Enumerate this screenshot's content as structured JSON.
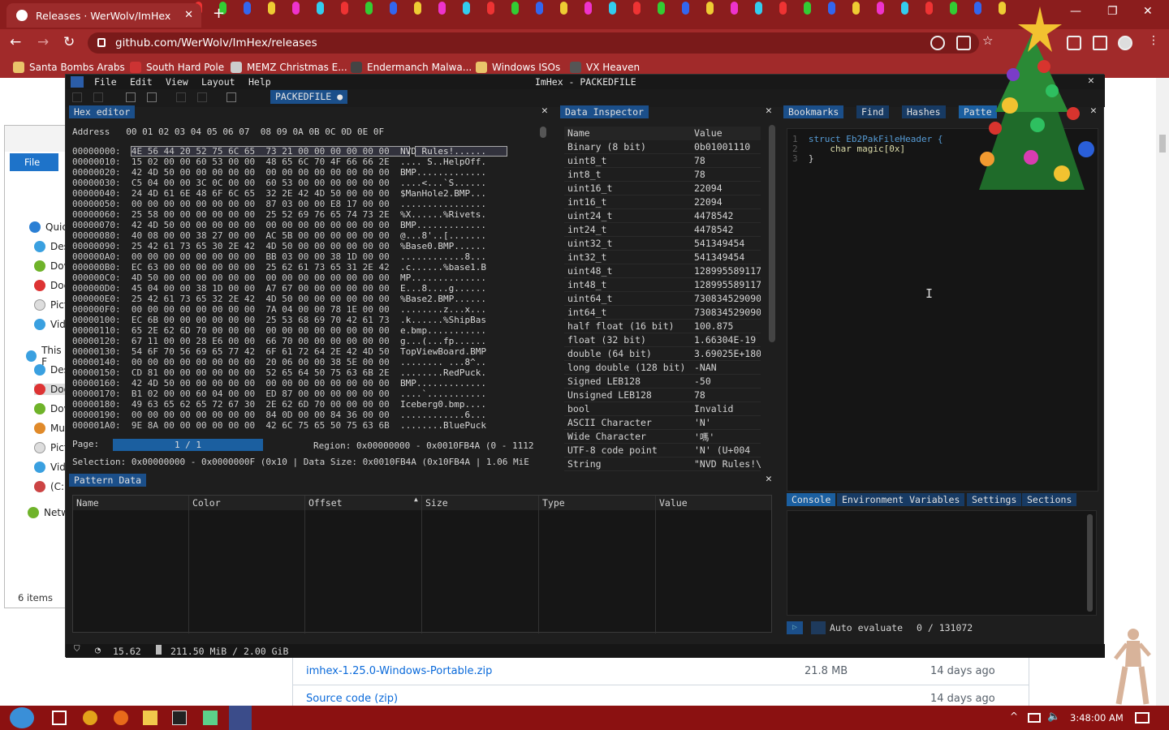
{
  "browser": {
    "tab_title": "Releases · WerWolv/ImHex",
    "url": "github.com/WerWolv/ImHex/releases",
    "bookmarks": [
      "Santa Bombs Arabs",
      "South Hard Pole",
      "MEMZ Christmas E...",
      "Endermanch Malwa...",
      "Windows ISOs",
      "VX Heaven"
    ]
  },
  "explorer": {
    "file_tab": "File",
    "items": [
      "Quic",
      "Des",
      "Dov",
      "Doc",
      "Pict",
      "Vid",
      "This F",
      "Des",
      "Doc",
      "Dov",
      "Mu",
      "Pict",
      "Vid",
      "(C:)",
      "Netw"
    ],
    "count": "6 items"
  },
  "github": {
    "assets": [
      {
        "name": "imhex-1.25.0-Windows-Portable.zip",
        "size": "21.8 MB",
        "date": "14 days ago"
      },
      {
        "name": "Source code (zip)",
        "size": "",
        "date": "14 days ago"
      }
    ]
  },
  "imhex": {
    "menus": [
      "File",
      "Edit",
      "View",
      "Layout",
      "Help"
    ],
    "title": "ImHex - PACKEDFILE",
    "provider_tab": "PACKEDFILE",
    "hex_editor": {
      "title": "Hex editor",
      "header": "Address   00 01 02 03 04 05 06 07  08 09 0A 0B 0C 0D 0E 0F",
      "rows": [
        {
          "off": "00000000:",
          "hex": "4E 56 44 20 52 75 6C 65  73 21 00 00 00 00 00 00",
          "ascii": "NVD Rules!......"
        },
        {
          "off": "00000010:",
          "hex": "15 02 00 00 60 53 00 00  48 65 6C 70 4F 66 66 2E",
          "ascii": ".... S..HelpOff."
        },
        {
          "off": "00000020:",
          "hex": "42 4D 50 00 00 00 00 00  00 00 00 00 00 00 00 00",
          "ascii": "BMP............."
        },
        {
          "off": "00000030:",
          "hex": "C5 04 00 00 3C 0C 00 00  60 53 00 00 00 00 00 00",
          "ascii": "....<...`S......"
        },
        {
          "off": "00000040:",
          "hex": "24 4D 61 6E 48 6F 6C 65  32 2E 42 4D 50 00 00 00",
          "ascii": "$ManHole2.BMP..."
        },
        {
          "off": "00000050:",
          "hex": "00 00 00 00 00 00 00 00  87 03 00 00 E8 17 00 00",
          "ascii": "................"
        },
        {
          "off": "00000060:",
          "hex": "25 58 00 00 00 00 00 00  25 52 69 76 65 74 73 2E",
          "ascii": "%X......%Rivets."
        },
        {
          "off": "00000070:",
          "hex": "42 4D 50 00 00 00 00 00  00 00 00 00 00 00 00 00",
          "ascii": "BMP............."
        },
        {
          "off": "00000080:",
          "hex": "40 08 00 00 38 27 00 00  AC 5B 00 00 00 00 00 00",
          "ascii": "@...8'..[......."
        },
        {
          "off": "00000090:",
          "hex": "25 42 61 73 65 30 2E 42  4D 50 00 00 00 00 00 00",
          "ascii": "%Base0.BMP......"
        },
        {
          "off": "000000A0:",
          "hex": "00 00 00 00 00 00 00 00  BB 03 00 00 38 1D 00 00",
          "ascii": "............8..."
        },
        {
          "off": "000000B0:",
          "hex": "EC 63 00 00 00 00 00 00  25 62 61 73 65 31 2E 42",
          "ascii": ".c......%base1.B"
        },
        {
          "off": "000000C0:",
          "hex": "4D 50 00 00 00 00 00 00  00 00 00 00 00 00 00 00",
          "ascii": "MP.............."
        },
        {
          "off": "000000D0:",
          "hex": "45 04 00 00 38 1D 00 00  A7 67 00 00 00 00 00 00",
          "ascii": "E...8....g......"
        },
        {
          "off": "000000E0:",
          "hex": "25 42 61 73 65 32 2E 42  4D 50 00 00 00 00 00 00",
          "ascii": "%Base2.BMP......"
        },
        {
          "off": "000000F0:",
          "hex": "00 00 00 00 00 00 00 00  7A 04 00 00 78 1E 00 00",
          "ascii": "........z...x..."
        },
        {
          "off": "00000100:",
          "hex": "EC 6B 00 00 00 00 00 00  25 53 68 69 70 42 61 73",
          "ascii": ".k......%ShipBas"
        },
        {
          "off": "00000110:",
          "hex": "65 2E 62 6D 70 00 00 00  00 00 00 00 00 00 00 00",
          "ascii": "e.bmp..........."
        },
        {
          "off": "00000120:",
          "hex": "67 11 00 00 28 E6 00 00  66 70 00 00 00 00 00 00",
          "ascii": "g...(...fp......"
        },
        {
          "off": "00000130:",
          "hex": "54 6F 70 56 69 65 77 42  6F 61 72 64 2E 42 4D 50",
          "ascii": "TopViewBoard.BMP"
        },
        {
          "off": "00000140:",
          "hex": "00 00 00 00 00 00 00 00  20 06 00 00 38 5E 00 00",
          "ascii": "........ ...8^.."
        },
        {
          "off": "00000150:",
          "hex": "CD 81 00 00 00 00 00 00  52 65 64 50 75 63 6B 2E",
          "ascii": "........RedPuck."
        },
        {
          "off": "00000160:",
          "hex": "42 4D 50 00 00 00 00 00  00 00 00 00 00 00 00 00",
          "ascii": "BMP............."
        },
        {
          "off": "00000170:",
          "hex": "B1 02 00 00 60 04 00 00  ED 87 00 00 00 00 00 00",
          "ascii": "....`..........."
        },
        {
          "off": "00000180:",
          "hex": "49 63 65 62 65 72 67 30  2E 62 6D 70 00 00 00 00",
          "ascii": "Iceberg0.bmp...."
        },
        {
          "off": "00000190:",
          "hex": "00 00 00 00 00 00 00 00  84 0D 00 00 84 36 00 00",
          "ascii": "............6..."
        },
        {
          "off": "000001A0:",
          "hex": "9E 8A 00 00 00 00 00 00  42 6C 75 65 50 75 63 6B",
          "ascii": "........BluePuck"
        }
      ],
      "page_label": "Page:",
      "page_value": "1 / 1",
      "region": "Region: 0x00000000 - 0x0010FB4A (0 - 1112",
      "selection": "Selection: 0x00000000 - 0x0000000F (0x10 | Data Size: 0x0010FB4A (0x10FB4A | 1.06 MiE"
    },
    "inspector": {
      "title": "Data Inspector",
      "col_name": "Name",
      "col_value": "Value",
      "rows": [
        {
          "name": "Binary (8 bit)",
          "value": "0b01001110"
        },
        {
          "name": "uint8_t",
          "value": "78"
        },
        {
          "name": "int8_t",
          "value": "78"
        },
        {
          "name": "uint16_t",
          "value": "22094"
        },
        {
          "name": "int16_t",
          "value": "22094"
        },
        {
          "name": "uint24_t",
          "value": "4478542"
        },
        {
          "name": "int24_t",
          "value": "4478542"
        },
        {
          "name": "uint32_t",
          "value": "541349454"
        },
        {
          "name": "int32_t",
          "value": "541349454"
        },
        {
          "name": "uint48_t",
          "value": "128995589117"
        },
        {
          "name": "int48_t",
          "value": "128995589117"
        },
        {
          "name": "uint64_t",
          "value": "730834529090"
        },
        {
          "name": "int64_t",
          "value": "730834529090"
        },
        {
          "name": "half float (16 bit)",
          "value": "100.875"
        },
        {
          "name": "float (32 bit)",
          "value": "1.66304E-19"
        },
        {
          "name": "double (64 bit)",
          "value": "3.69025E+180"
        },
        {
          "name": "long double (128 bit)",
          "value": "-NAN"
        },
        {
          "name": "Signed LEB128",
          "value": "-50"
        },
        {
          "name": "Unsigned LEB128",
          "value": "78"
        },
        {
          "name": "bool",
          "value": "Invalid"
        },
        {
          "name": "ASCII Character",
          "value": "'N'"
        },
        {
          "name": "Wide Character",
          "value": "'嗎'"
        },
        {
          "name": "UTF-8 code point",
          "value": "'N' (U+004"
        },
        {
          "name": "String",
          "value": "\"NVD Rules!\\"
        }
      ]
    },
    "right_tabs": [
      "Bookmarks",
      "Find",
      "Hashes",
      "Patte"
    ],
    "code": [
      {
        "ln": "1",
        "text": "struct Eb2PakFileHeader {"
      },
      {
        "ln": "2",
        "text": "    char magic[0x]"
      },
      {
        "ln": "3",
        "text": "}"
      }
    ],
    "bottom_tabs": [
      "Console",
      "Environment Variables",
      "Settings",
      "Sections"
    ],
    "auto_evaluate": "Auto evaluate",
    "eval_count": "0 / 131072",
    "pattern_data": {
      "title": "Pattern Data",
      "columns": [
        "Name",
        "Color",
        "Offset",
        "Size",
        "Type",
        "Value"
      ]
    },
    "status": {
      "fps": "15.62",
      "memory": "211.50 MiB / 2.00 GiB"
    }
  },
  "taskbar": {
    "time": "3:48:00 AM"
  }
}
